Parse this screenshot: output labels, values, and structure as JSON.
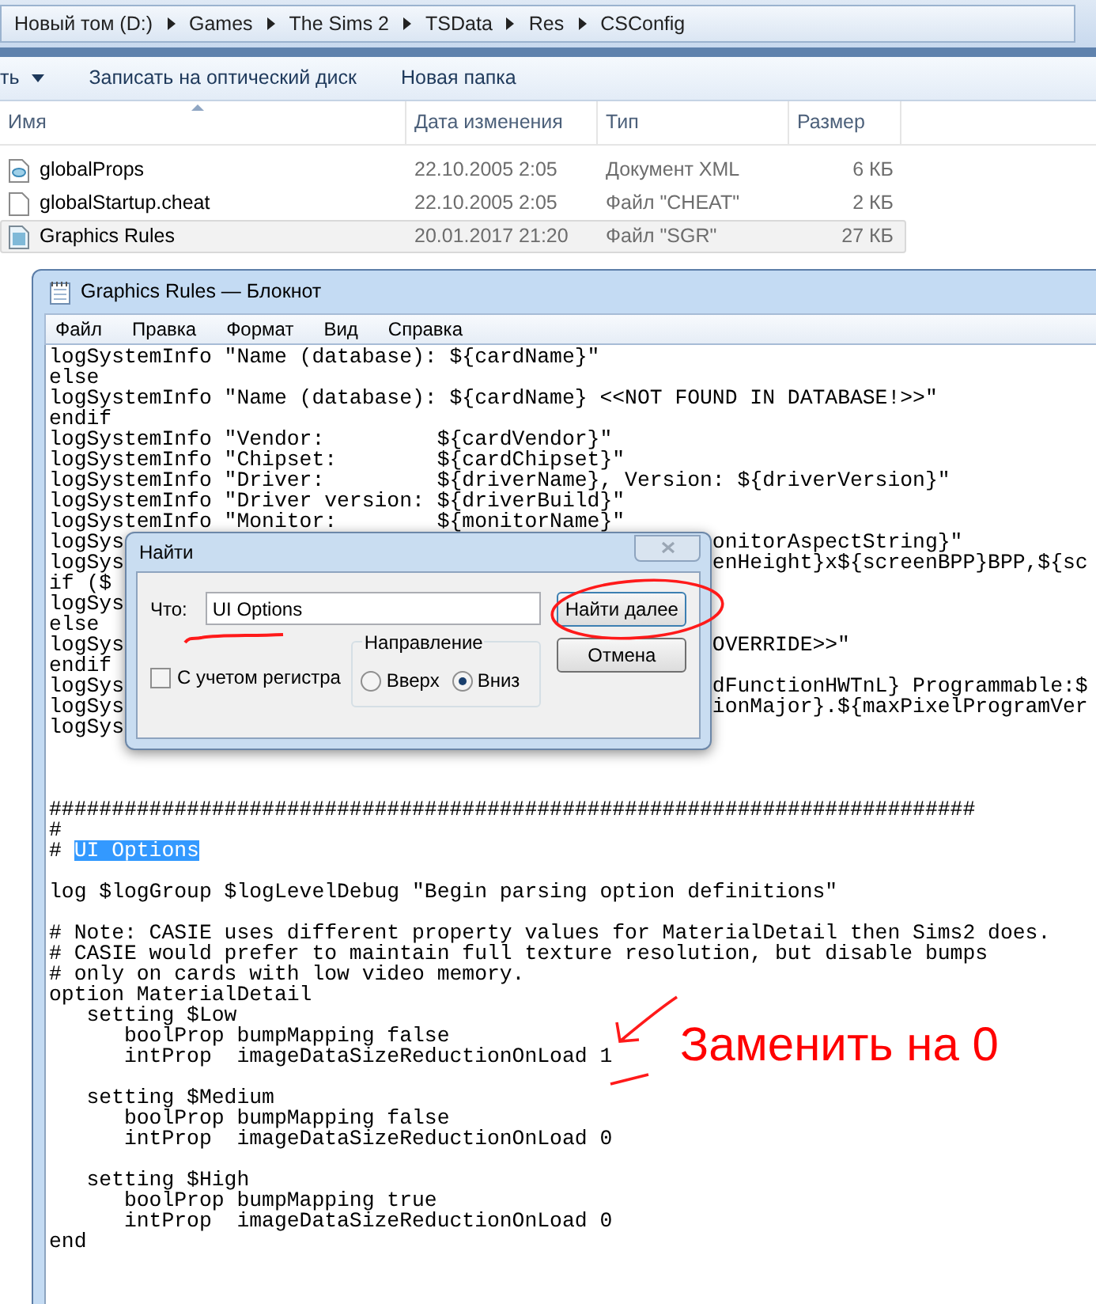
{
  "explorer": {
    "breadcrumbs": [
      "Новый том (D:)",
      "Games",
      "The Sims 2",
      "TSData",
      "Res",
      "CSConfig"
    ],
    "toolbar": [
      {
        "label": "ть",
        "dropdown": true
      },
      {
        "label": "Записать на оптический диск",
        "dropdown": false
      },
      {
        "label": "Новая папка",
        "dropdown": false
      }
    ],
    "columns": [
      "Имя",
      "Дата изменения",
      "Тип",
      "Размер"
    ],
    "files": [
      {
        "name": "globalProps",
        "date": "22.10.2005 2:05",
        "type": "Документ XML",
        "size": "6 КБ",
        "kind": "xml",
        "selected": false
      },
      {
        "name": "globalStartup.cheat",
        "date": "22.10.2005 2:05",
        "type": "Файл \"CHEAT\"",
        "size": "2 КБ",
        "kind": "blank",
        "selected": false
      },
      {
        "name": "Graphics Rules",
        "date": "20.01.2017 21:20",
        "type": "Файл \"SGR\"",
        "size": "27 КБ",
        "kind": "sgr",
        "selected": true
      }
    ]
  },
  "notepad": {
    "title": "Graphics Rules — Блокнот",
    "menu": [
      "Файл",
      "Правка",
      "Формат",
      "Вид",
      "Справка"
    ],
    "lines": [
      {
        "kind": "text",
        "text": "logSystemInfo \"Name (database): ${cardName}\""
      },
      {
        "kind": "text",
        "text": "else"
      },
      {
        "kind": "text",
        "text": "logSystemInfo \"Name (database): ${cardName} <<NOT FOUND IN DATABASE!>>\""
      },
      {
        "kind": "text",
        "text": "endif"
      },
      {
        "kind": "text",
        "text": "logSystemInfo \"Vendor:         ${cardVendor}\""
      },
      {
        "kind": "text",
        "text": "logSystemInfo \"Chipset:        ${cardChipset}\""
      },
      {
        "kind": "text",
        "text": "logSystemInfo \"Driver:         ${driverName}, Version: ${driverVersion}\""
      },
      {
        "kind": "text",
        "text": "logSystemInfo \"Driver version: ${driverBuild}\""
      },
      {
        "kind": "text",
        "text": "logSystemInfo \"Monitor:        ${monitorName}\""
      },
      {
        "kind": "covered",
        "text": "logSys",
        "tail": "onitorAspectString}\""
      },
      {
        "kind": "covered",
        "text": "logSys",
        "tail": "enHeight}x${screenBPP}BPP,${sc"
      },
      {
        "kind": "covered",
        "text": "if ($"
      },
      {
        "kind": "covered",
        "text": "logSys"
      },
      {
        "kind": "text",
        "text": "else"
      },
      {
        "kind": "covered",
        "text": "logSys",
        "tail": "OVERRIDE>>\""
      },
      {
        "kind": "text",
        "text": "endif"
      },
      {
        "kind": "covered",
        "text": "logSys",
        "tail": "dFunctionHWTnL} Programmable:$"
      },
      {
        "kind": "covered",
        "text": "logSys",
        "tail": "ionMajor}.${maxPixelProgramVer"
      },
      {
        "kind": "covered",
        "text": "logSys"
      },
      {
        "kind": "blank"
      },
      {
        "kind": "blank"
      },
      {
        "kind": "blank"
      },
      {
        "kind": "text",
        "text": "##########################################################################"
      },
      {
        "kind": "text",
        "text": "#"
      },
      {
        "kind": "selection",
        "text": "# ",
        "selected": "UI Options"
      },
      {
        "kind": "blank"
      },
      {
        "kind": "text",
        "text": "log $logGroup $logLevelDebug \"Begin parsing option definitions\""
      },
      {
        "kind": "blank"
      },
      {
        "kind": "text",
        "text": "# Note: CASIE uses different property values for MaterialDetail then Sims2 does."
      },
      {
        "kind": "text",
        "text": "# CASIE would prefer to maintain full texture resolution, but disable bumps"
      },
      {
        "kind": "text",
        "text": "# only on cards with low video memory."
      },
      {
        "kind": "text",
        "text": "option MaterialDetail"
      },
      {
        "kind": "text",
        "text": "   setting $Low"
      },
      {
        "kind": "text",
        "text": "      boolProp bumpMapping false"
      },
      {
        "kind": "text",
        "text": "      intProp  imageDataSizeReductionOnLoad 1"
      },
      {
        "kind": "blank"
      },
      {
        "kind": "text",
        "text": "   setting $Medium"
      },
      {
        "kind": "text",
        "text": "      boolProp bumpMapping false"
      },
      {
        "kind": "text",
        "text": "      intProp  imageDataSizeReductionOnLoad 0"
      },
      {
        "kind": "blank"
      },
      {
        "kind": "text",
        "text": "   setting $High"
      },
      {
        "kind": "text",
        "text": "      boolProp bumpMapping true"
      },
      {
        "kind": "text",
        "text": "      intProp  imageDataSizeReductionOnLoad 0"
      },
      {
        "kind": "text",
        "text": "end"
      }
    ]
  },
  "find_dialog": {
    "title": "Найти",
    "label": "Что:",
    "value": "UI Options",
    "buttons": [
      "Найти далее",
      "Отмена"
    ],
    "match_case": {
      "label": "С учетом регистра",
      "checked": false
    },
    "direction": {
      "label": "Направление",
      "options": [
        {
          "label": "Вверх",
          "selected": false
        },
        {
          "label": "Вниз",
          "selected": true
        }
      ]
    }
  },
  "annotation": {
    "text": "Заменить на 0"
  }
}
